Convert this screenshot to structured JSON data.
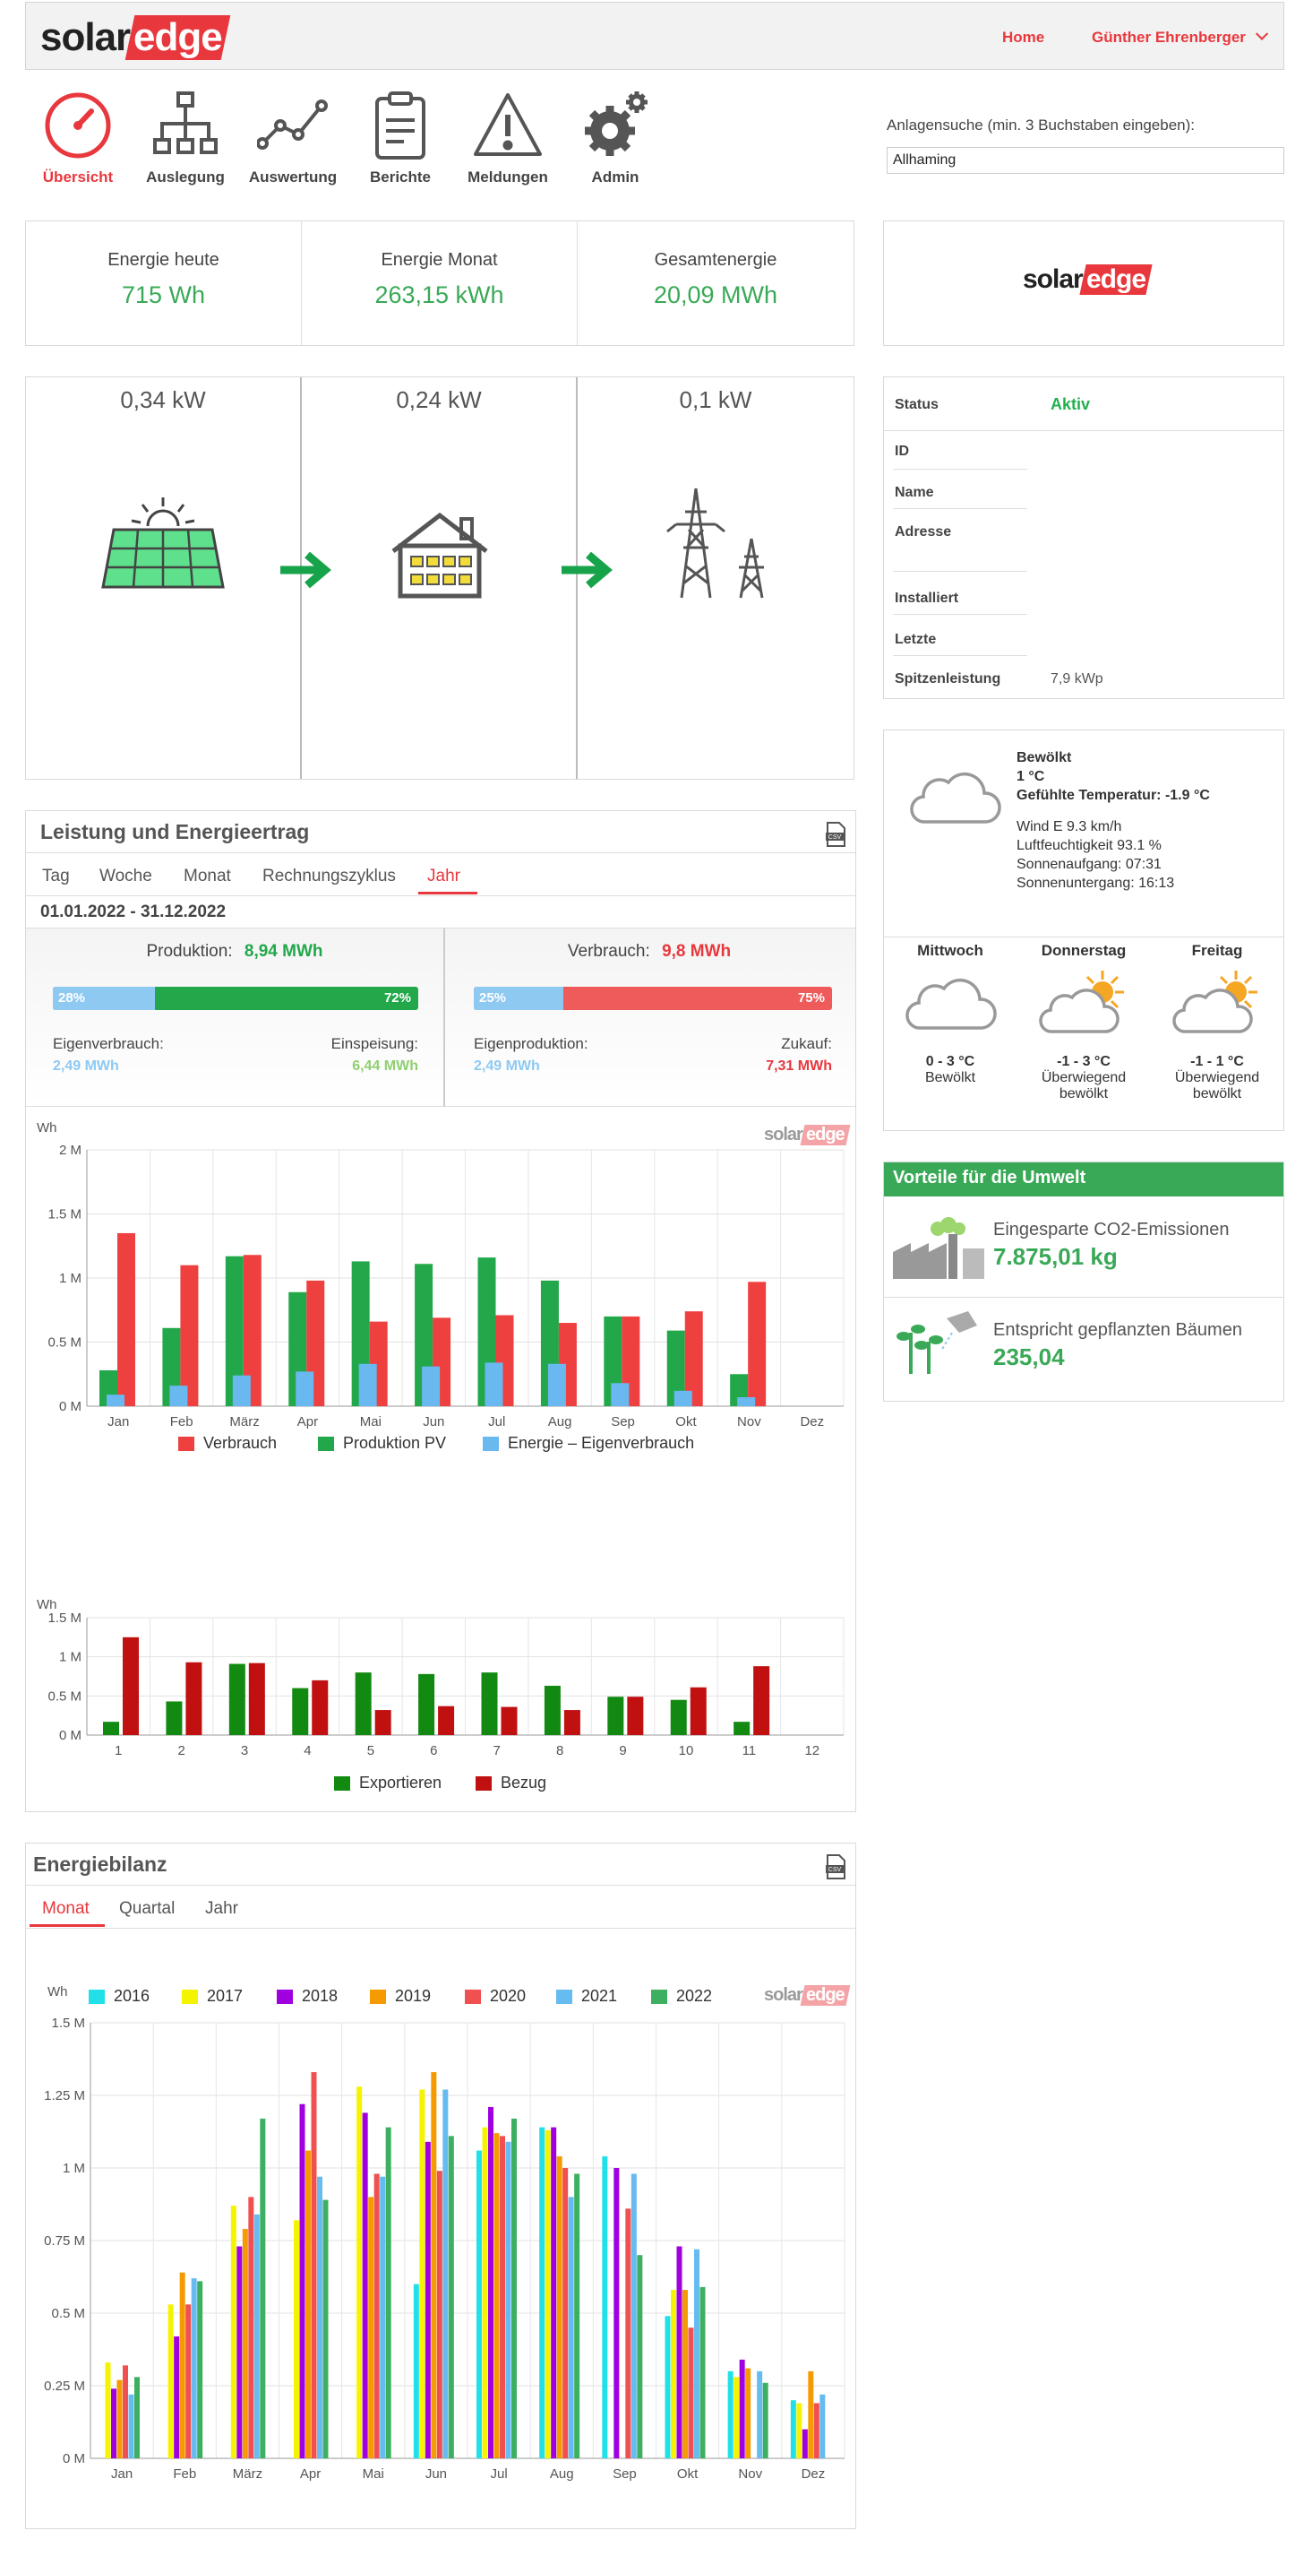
{
  "header": {
    "home": "Home",
    "user": "Günther Ehrenberger"
  },
  "nav": [
    {
      "label": "Übersicht",
      "icon": "gauge-icon"
    },
    {
      "label": "Auslegung",
      "icon": "layout-icon"
    },
    {
      "label": "Auswertung",
      "icon": "trend-icon"
    },
    {
      "label": "Berichte",
      "icon": "clipboard-icon"
    },
    {
      "label": "Meldungen",
      "icon": "warning-icon"
    },
    {
      "label": "Admin",
      "icon": "gears-icon"
    }
  ],
  "search": {
    "label": "Anlagensuche (min. 3 Buchstaben eingeben):",
    "value": "Allhaming"
  },
  "kpis": [
    {
      "label": "Energie heute",
      "value": "715 Wh"
    },
    {
      "label": "Energie Monat",
      "value": "263,15 kWh"
    },
    {
      "label": "Gesamtenergie",
      "value": "20,09 MWh"
    }
  ],
  "flow": {
    "pv": "0,34 kW",
    "house": "0,24 kW",
    "grid": "0,1 kW"
  },
  "status": {
    "rows": [
      {
        "label": "Status",
        "value": "Aktiv"
      },
      {
        "label": "ID",
        "value": ""
      },
      {
        "label": "Name",
        "value": ""
      },
      {
        "label": "Adresse",
        "value": ""
      },
      {
        "label": "Installiert",
        "value": ""
      },
      {
        "label": "Letzte",
        "value": ""
      },
      {
        "label": "Spitzenleistung",
        "value": "7,9 kWp"
      }
    ]
  },
  "weather": {
    "current": {
      "cond": "Bewölkt",
      "temp": "1 °C",
      "felt": "Gefühlte Temperatur: -1.9 °C",
      "wind": "Wind E 9.3 km/h",
      "humidity": "Luftfeuchtigkeit 93.1 %",
      "sunrise": "Sonnenaufgang: 07:31",
      "sunset": "Sonnenuntergang: 16:13"
    },
    "forecast": [
      {
        "day": "Mittwoch",
        "temp": "0 - 3 °C",
        "cond1": "Bewölkt",
        "cond2": "",
        "icon": "cloud-icon"
      },
      {
        "day": "Donnerstag",
        "temp": "-1 - 3 °C",
        "cond1": "Überwiegend",
        "cond2": "bewölkt",
        "icon": "sun-cloud-icon"
      },
      {
        "day": "Freitag",
        "temp": "-1 - 1 °C",
        "cond1": "Überwiegend",
        "cond2": "bewölkt",
        "icon": "sun-cloud-icon"
      }
    ]
  },
  "env": {
    "title": "Vorteile für die Umwelt",
    "co2_label": "Eingesparte CO2-Emissionen",
    "co2_value": "7.875,01 kg",
    "trees_label": "Entspricht gepflanzten Bäumen",
    "trees_value": "235,04"
  },
  "power": {
    "title": "Leistung und Energieertrag",
    "tabs": [
      "Tag",
      "Woche",
      "Monat",
      "Rechnungszyklus",
      "Jahr"
    ],
    "active_tab": "Jahr",
    "range": "01.01.2022 - 31.12.2022",
    "production_label": "Produktion:",
    "production_value": "8,94 MWh",
    "consumption_label": "Verbrauch:",
    "consumption_value": "9,8 MWh",
    "prod_bar": {
      "left": "28%",
      "right": "72%",
      "fraction": 0.28
    },
    "cons_bar": {
      "left": "25%",
      "right": "75%",
      "fraction": 0.25
    },
    "self_label": "Eigenverbrauch:",
    "self_value": "2,49 MWh",
    "feed_label": "Einspeisung:",
    "feed_value": "6,44 MWh",
    "own_label": "Eigenproduktion:",
    "own_value": "2,49 MWh",
    "buy_label": "Zukauf:",
    "buy_value": "7,31 MWh"
  },
  "energy_balance": {
    "title": "Energiebilanz",
    "tabs": [
      "Monat",
      "Quartal",
      "Jahr"
    ],
    "active_tab": "Monat"
  },
  "chart_data": [
    {
      "type": "bar",
      "ylabel": "Wh",
      "ylim": [
        0,
        2000000
      ],
      "yticks": [
        "0 M",
        "0.5 M",
        "1 M",
        "1.5 M",
        "2 M"
      ],
      "categories": [
        "Jan",
        "Feb",
        "März",
        "Apr",
        "Mai",
        "Jun",
        "Jul",
        "Aug",
        "Sep",
        "Okt",
        "Nov",
        "Dez"
      ],
      "series": [
        {
          "name": "Verbrauch",
          "color": "#ef4040",
          "values": [
            1350000,
            1100000,
            1180000,
            980000,
            660000,
            690000,
            710000,
            650000,
            700000,
            740000,
            970000,
            0
          ]
        },
        {
          "name": "Produktion PV",
          "color": "#22a84a",
          "values": [
            280000,
            610000,
            1170000,
            890000,
            1130000,
            1110000,
            1160000,
            980000,
            700000,
            590000,
            250000,
            0
          ]
        },
        {
          "name": "Energie – Eigenverbrauch",
          "color": "#6ab8f0",
          "values": [
            90000,
            160000,
            240000,
            270000,
            330000,
            310000,
            340000,
            330000,
            180000,
            120000,
            70000,
            0
          ]
        }
      ]
    },
    {
      "type": "bar",
      "ylabel": "Wh",
      "ylim": [
        0,
        1500000
      ],
      "yticks": [
        "0 M",
        "0.5 M",
        "1 M",
        "1.5 M"
      ],
      "categories": [
        "1",
        "2",
        "3",
        "4",
        "5",
        "6",
        "7",
        "8",
        "9",
        "10",
        "11",
        "12"
      ],
      "series": [
        {
          "name": "Exportieren",
          "color": "#128a12",
          "values": [
            170000,
            430000,
            910000,
            600000,
            800000,
            780000,
            800000,
            630000,
            490000,
            450000,
            170000,
            0
          ]
        },
        {
          "name": "Bezug",
          "color": "#c01010",
          "values": [
            1250000,
            930000,
            920000,
            700000,
            320000,
            370000,
            360000,
            320000,
            490000,
            610000,
            880000,
            0
          ]
        }
      ]
    },
    {
      "type": "bar",
      "ylabel": "Wh",
      "ylim": [
        0,
        1500000
      ],
      "yticks": [
        "0 M",
        "0.25 M",
        "0.5 M",
        "0.75 M",
        "1 M",
        "1.25 M",
        "1.5 M"
      ],
      "categories": [
        "Jan",
        "Feb",
        "März",
        "Apr",
        "Mai",
        "Jun",
        "Jul",
        "Aug",
        "Sep",
        "Okt",
        "Nov",
        "Dez"
      ],
      "series": [
        {
          "name": "2016",
          "color": "#22e0e8",
          "values": [
            0,
            0,
            0,
            0,
            0,
            600000,
            1060000,
            1140000,
            1040000,
            490000,
            300000,
            200000
          ]
        },
        {
          "name": "2017",
          "color": "#f4f400",
          "values": [
            330000,
            530000,
            870000,
            820000,
            1280000,
            1270000,
            1140000,
            1130000,
            0,
            580000,
            280000,
            190000
          ]
        },
        {
          "name": "2018",
          "color": "#a000e0",
          "values": [
            240000,
            420000,
            730000,
            1220000,
            1190000,
            1090000,
            1210000,
            1140000,
            1000000,
            730000,
            340000,
            100000
          ]
        },
        {
          "name": "2019",
          "color": "#f59a00",
          "values": [
            270000,
            640000,
            790000,
            1060000,
            900000,
            1330000,
            1120000,
            1040000,
            0,
            580000,
            310000,
            300000
          ]
        },
        {
          "name": "2020",
          "color": "#f05050",
          "values": [
            320000,
            530000,
            900000,
            1330000,
            980000,
            990000,
            1110000,
            1000000,
            860000,
            450000,
            0,
            190000
          ]
        },
        {
          "name": "2021",
          "color": "#66bbf0",
          "values": [
            220000,
            620000,
            840000,
            970000,
            970000,
            1270000,
            1090000,
            900000,
            980000,
            720000,
            300000,
            220000
          ]
        },
        {
          "name": "2022",
          "color": "#3cb060",
          "values": [
            280000,
            610000,
            1170000,
            890000,
            1140000,
            1110000,
            1170000,
            980000,
            700000,
            590000,
            260000,
            0
          ]
        }
      ]
    }
  ]
}
